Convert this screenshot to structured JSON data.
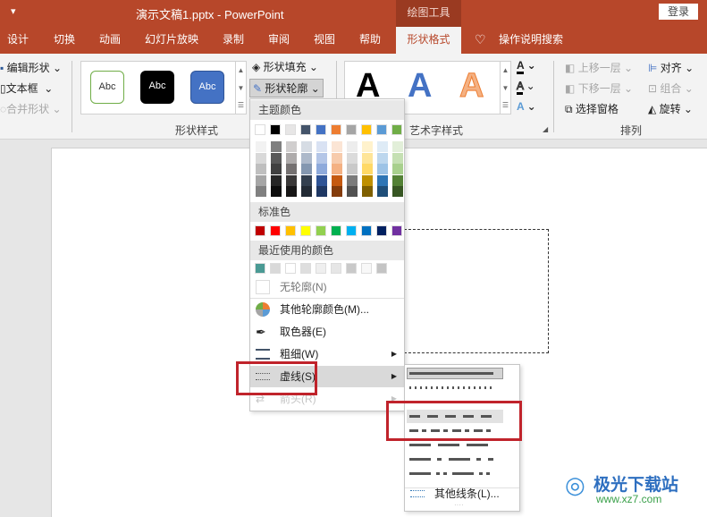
{
  "titlebar": {
    "qat_icon": "customize-qat-icon",
    "qat_glyph": "▾",
    "title": "演示文稿1.pptx  -  PowerPoint",
    "context_tab": "绘图工具",
    "login": "登录"
  },
  "tabs": [
    {
      "label": "设计"
    },
    {
      "label": "切换"
    },
    {
      "label": "动画"
    },
    {
      "label": "幻灯片放映"
    },
    {
      "label": "录制"
    },
    {
      "label": "审阅"
    },
    {
      "label": "视图"
    },
    {
      "label": "帮助"
    },
    {
      "label": "形状格式",
      "active": true
    },
    {
      "label": "操作说明搜索"
    }
  ],
  "ribbon": {
    "insert_shapes": {
      "edit_shape": "编辑形状",
      "text_box": "文本框",
      "merge_shapes": "合并形状"
    },
    "shape_styles": {
      "label": "形状样式",
      "samples": [
        "Abc",
        "Abc",
        "Abc"
      ],
      "shape_fill": "形状填充",
      "shape_outline": "形状轮廓"
    },
    "wordart": {
      "label": "艺术字样式",
      "samples": [
        "A",
        "A",
        "A"
      ]
    },
    "arrange": {
      "label": "排列",
      "bring_forward": "上移一层",
      "send_backward": "下移一层",
      "selection_pane": "选择窗格",
      "align": "对齐",
      "group": "组合",
      "rotate": "旋转"
    }
  },
  "outline_menu": {
    "theme_colors_header": "主题颜色",
    "theme_colors": [
      "#ffffff",
      "#000000",
      "#e7e6e6",
      "#44546a",
      "#4472c4",
      "#ed7d31",
      "#a5a5a5",
      "#ffc000",
      "#5b9bd5",
      "#70ad47"
    ],
    "theme_shades": [
      [
        "#f2f2f2",
        "#d9d9d9",
        "#bfbfbf",
        "#a6a6a6",
        "#808080"
      ],
      [
        "#7f7f7f",
        "#595959",
        "#404040",
        "#262626",
        "#0d0d0d"
      ],
      [
        "#d0cece",
        "#aeabab",
        "#757171",
        "#3a3838",
        "#171616"
      ],
      [
        "#d6dce4",
        "#adb9ca",
        "#8497b0",
        "#333f4f",
        "#222a35"
      ],
      [
        "#d9e2f3",
        "#b4c6e7",
        "#8eaadb",
        "#2f5496",
        "#1f3864"
      ],
      [
        "#fbe5d5",
        "#f7cbac",
        "#f4b183",
        "#c55a11",
        "#843c0c"
      ],
      [
        "#ededed",
        "#dbdbdb",
        "#c9c9c9",
        "#7b7b7b",
        "#525252"
      ],
      [
        "#fff2cc",
        "#fee599",
        "#ffd966",
        "#bf9000",
        "#7f6000"
      ],
      [
        "#deebf6",
        "#bdd7ee",
        "#9dc3e6",
        "#2e75b5",
        "#1f4e79"
      ],
      [
        "#e2efd9",
        "#c5e0b3",
        "#a8d08d",
        "#538135",
        "#375623"
      ]
    ],
    "standard_colors_header": "标准色",
    "standard_colors": [
      "#c00000",
      "#ff0000",
      "#ffc000",
      "#ffff00",
      "#92d050",
      "#00b050",
      "#00b0f0",
      "#0070c0",
      "#002060",
      "#7030a0"
    ],
    "recent_colors_header": "最近使用的颜色",
    "recent_colors": [
      "#4a9a94",
      "#d9d9d9",
      "#ffffff",
      "#dedede",
      "#efefef",
      "#e6e6e6",
      "#c9c9c9",
      "#f8f8f8",
      "#c4c4c4"
    ],
    "no_outline": "无轮廓(N)",
    "more_colors": "其他轮廓颜色(M)...",
    "eyedropper": "取色器(E)",
    "weight": "粗细(W)",
    "dashes": "虚线(S)",
    "arrows": "箭头(R)"
  },
  "dash_submenu": {
    "options": [
      "solid",
      "round-dot",
      "square-dot",
      "dash",
      "dash-dot",
      "long-dash",
      "long-dash-dot",
      "long-dash-dot-dot"
    ],
    "selected": "solid",
    "hovered": "dash",
    "more_lines": "其他线条(L)..."
  },
  "watermark": {
    "name": "极光下载站",
    "url": "www.xz7.com"
  },
  "colors": {
    "brand": "#b7472a",
    "highlight_box": "#c0232b"
  }
}
